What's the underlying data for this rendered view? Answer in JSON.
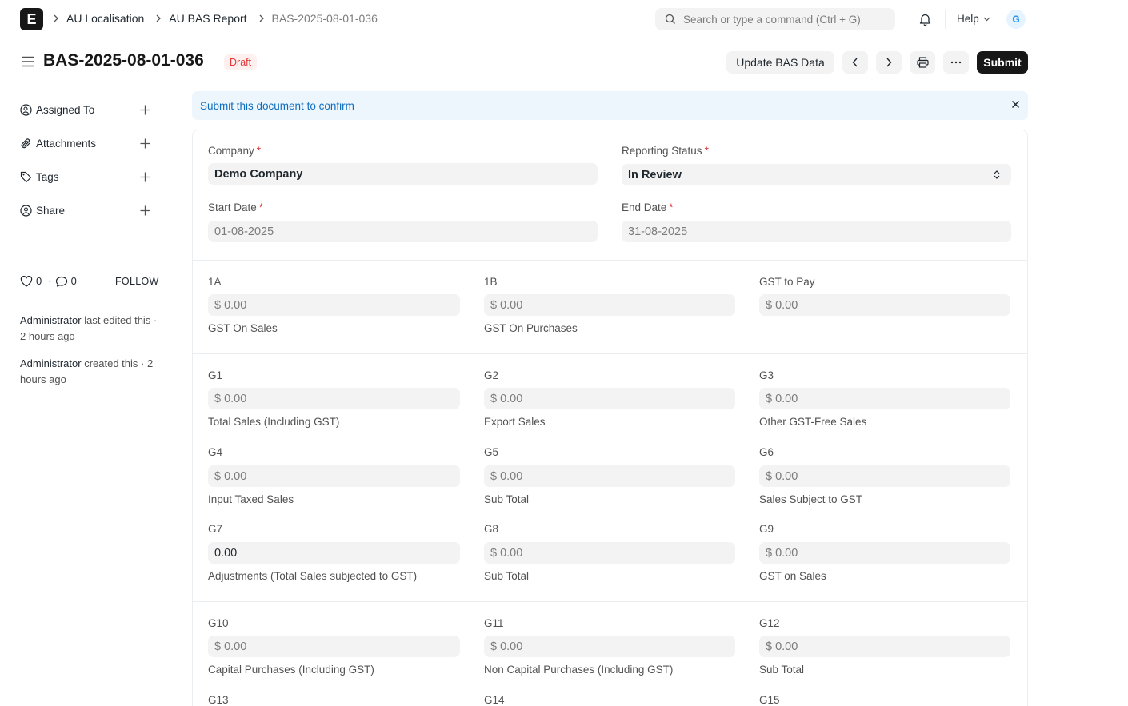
{
  "navbar": {
    "logo_letter": "E",
    "breadcrumbs": [
      "AU Localisation",
      "AU BAS Report",
      "BAS-2025-08-01-036"
    ],
    "search_placeholder": "Search or type a command (Ctrl + G)",
    "help_label": "Help",
    "avatar_initial": "G"
  },
  "page": {
    "title": "BAS-2025-08-01-036",
    "status": "Draft",
    "update_button": "Update BAS Data",
    "submit_button": "Submit"
  },
  "sidebar": {
    "items": [
      {
        "label": "Assigned To"
      },
      {
        "label": "Attachments"
      },
      {
        "label": "Tags"
      },
      {
        "label": "Share"
      }
    ],
    "likes": "0",
    "comments": "0",
    "follow": "FOLLOW",
    "activity": [
      {
        "user": "Administrator",
        "text": "last edited this · 2 hours ago"
      },
      {
        "user": "Administrator",
        "text": "created this · 2 hours ago"
      }
    ]
  },
  "alert": {
    "message": "Submit this document to confirm"
  },
  "form": {
    "company": {
      "label": "Company",
      "value": "Demo Company"
    },
    "reporting_status": {
      "label": "Reporting Status",
      "value": "In Review"
    },
    "start_date": {
      "label": "Start Date",
      "value": "01-08-2025"
    },
    "end_date": {
      "label": "End Date",
      "value": "31-08-2025"
    },
    "fields": [
      {
        "code": "1A",
        "value": "$ 0.00",
        "desc": "GST On Sales"
      },
      {
        "code": "1B",
        "value": "$ 0.00",
        "desc": "GST On Purchases"
      },
      {
        "code": "GST to Pay",
        "value": "$ 0.00",
        "desc": ""
      },
      {
        "code": "G1",
        "value": "$ 0.00",
        "desc": "Total Sales (Including GST)"
      },
      {
        "code": "G2",
        "value": "$ 0.00",
        "desc": "Export Sales"
      },
      {
        "code": "G3",
        "value": "$ 0.00",
        "desc": "Other GST-Free Sales"
      },
      {
        "code": "G4",
        "value": "$ 0.00",
        "desc": "Input Taxed Sales"
      },
      {
        "code": "G5",
        "value": "$ 0.00",
        "desc": "Sub Total"
      },
      {
        "code": "G6",
        "value": "$ 0.00",
        "desc": "Sales Subject to GST"
      },
      {
        "code": "G7",
        "value": "0.00",
        "desc": "Adjustments (Total Sales subjected to GST)"
      },
      {
        "code": "G8",
        "value": "$ 0.00",
        "desc": "Sub Total"
      },
      {
        "code": "G9",
        "value": "$ 0.00",
        "desc": "GST on Sales"
      },
      {
        "code": "G10",
        "value": "$ 0.00",
        "desc": "Capital Purchases (Including GST)"
      },
      {
        "code": "G11",
        "value": "$ 0.00",
        "desc": "Non Capital Purchases (Including GST)"
      },
      {
        "code": "G12",
        "value": "$ 0.00",
        "desc": "Sub Total"
      },
      {
        "code": "G13",
        "value": "",
        "desc": ""
      },
      {
        "code": "G14",
        "value": "",
        "desc": ""
      },
      {
        "code": "G15",
        "value": "",
        "desc": ""
      }
    ]
  }
}
